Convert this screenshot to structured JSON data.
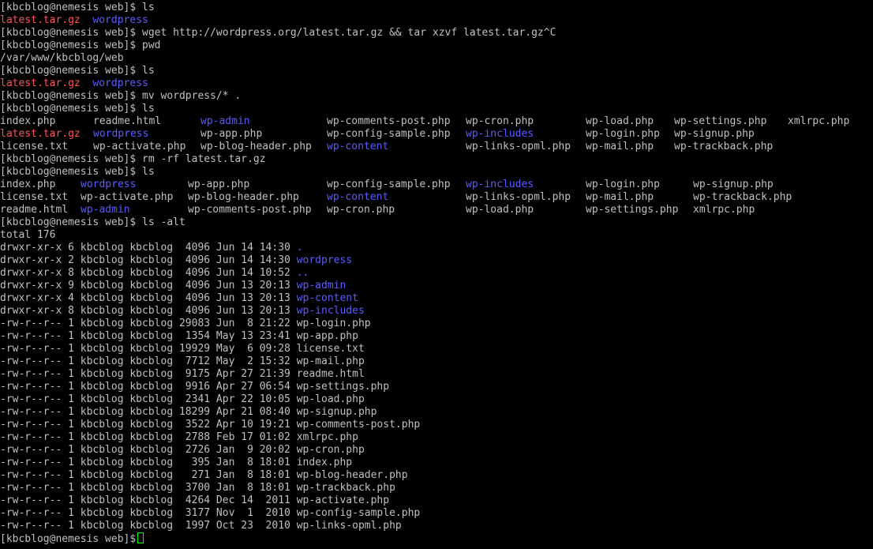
{
  "prompt": "[kbcblog@nemesis web]$",
  "colors": {
    "text": "#c0c0c0",
    "archive": "#ff5555",
    "dir": "#5c5cff",
    "cursor": "#00ff00",
    "bg": "#000000"
  },
  "commands": {
    "c1": "ls",
    "c2": "wget http://wordpress.org/latest.tar.gz && tar xzvf latest.tar.gz^C",
    "c3": "pwd",
    "c4": "ls",
    "c5": "mv wordpress/* .",
    "c6": "ls",
    "c7": "rm -rf latest.tar.gz",
    "c8": "ls",
    "c9": "ls -alt"
  },
  "out1": [
    "latest.tar.gz",
    "wordpress"
  ],
  "pwd_out": "/var/www/kbcblog/web",
  "out4": [
    "latest.tar.gz",
    "wordpress"
  ],
  "ls6": [
    [
      "index.php",
      "readme.html",
      "wp-admin",
      "wp-comments-post.php",
      "wp-cron.php",
      "wp-load.php",
      "wp-settings.php",
      "xmlrpc.php"
    ],
    [
      "latest.tar.gz",
      "wordpress",
      "wp-app.php",
      "wp-config-sample.php",
      "wp-includes",
      "wp-login.php",
      "wp-signup.php"
    ],
    [
      "license.txt",
      "wp-activate.php",
      "wp-blog-header.php",
      "wp-content",
      "wp-links-opml.php",
      "wp-mail.php",
      "wp-trackback.php"
    ]
  ],
  "ls8": [
    [
      "index.php",
      "wordpress",
      "wp-app.php",
      "wp-config-sample.php",
      "wp-includes",
      "wp-login.php",
      "wp-signup.php"
    ],
    [
      "license.txt",
      "wp-activate.php",
      "wp-blog-header.php",
      "wp-content",
      "wp-links-opml.php",
      "wp-mail.php",
      "wp-trackback.php"
    ],
    [
      "readme.html",
      "wp-admin",
      "wp-comments-post.php",
      "wp-cron.php",
      "wp-load.php",
      "wp-settings.php",
      "xmlrpc.php"
    ]
  ],
  "total": "total 176",
  "listing": [
    {
      "meta": "drwxr-xr-x 6 kbcblog kbcblog  4096 Jun 14 14:30 ",
      "name": "."
    },
    {
      "meta": "drwxr-xr-x 2 kbcblog kbcblog  4096 Jun 14 14:30 ",
      "name": "wordpress"
    },
    {
      "meta": "drwxr-xr-x 8 kbcblog kbcblog  4096 Jun 14 10:52 ",
      "name": ".."
    },
    {
      "meta": "drwxr-xr-x 9 kbcblog kbcblog  4096 Jun 13 20:13 ",
      "name": "wp-admin"
    },
    {
      "meta": "drwxr-xr-x 4 kbcblog kbcblog  4096 Jun 13 20:13 ",
      "name": "wp-content"
    },
    {
      "meta": "drwxr-xr-x 8 kbcblog kbcblog  4096 Jun 13 20:13 ",
      "name": "wp-includes"
    },
    {
      "meta": "-rw-r--r-- 1 kbcblog kbcblog 29083 Jun  8 21:22 ",
      "name": "wp-login.php"
    },
    {
      "meta": "-rw-r--r-- 1 kbcblog kbcblog  1354 May 13 23:41 ",
      "name": "wp-app.php"
    },
    {
      "meta": "-rw-r--r-- 1 kbcblog kbcblog 19929 May  6 09:28 ",
      "name": "license.txt"
    },
    {
      "meta": "-rw-r--r-- 1 kbcblog kbcblog  7712 May  2 15:32 ",
      "name": "wp-mail.php"
    },
    {
      "meta": "-rw-r--r-- 1 kbcblog kbcblog  9175 Apr 27 21:39 ",
      "name": "readme.html"
    },
    {
      "meta": "-rw-r--r-- 1 kbcblog kbcblog  9916 Apr 27 06:54 ",
      "name": "wp-settings.php"
    },
    {
      "meta": "-rw-r--r-- 1 kbcblog kbcblog  2341 Apr 22 10:05 ",
      "name": "wp-load.php"
    },
    {
      "meta": "-rw-r--r-- 1 kbcblog kbcblog 18299 Apr 21 08:40 ",
      "name": "wp-signup.php"
    },
    {
      "meta": "-rw-r--r-- 1 kbcblog kbcblog  3522 Apr 10 19:21 ",
      "name": "wp-comments-post.php"
    },
    {
      "meta": "-rw-r--r-- 1 kbcblog kbcblog  2788 Feb 17 01:02 ",
      "name": "xmlrpc.php"
    },
    {
      "meta": "-rw-r--r-- 1 kbcblog kbcblog  2726 Jan  9 20:02 ",
      "name": "wp-cron.php"
    },
    {
      "meta": "-rw-r--r-- 1 kbcblog kbcblog   395 Jan  8 18:01 ",
      "name": "index.php"
    },
    {
      "meta": "-rw-r--r-- 1 kbcblog kbcblog   271 Jan  8 18:01 ",
      "name": "wp-blog-header.php"
    },
    {
      "meta": "-rw-r--r-- 1 kbcblog kbcblog  3700 Jan  8 18:01 ",
      "name": "wp-trackback.php"
    },
    {
      "meta": "-rw-r--r-- 1 kbcblog kbcblog  4264 Dec 14  2011 ",
      "name": "wp-activate.php"
    },
    {
      "meta": "-rw-r--r-- 1 kbcblog kbcblog  3177 Nov  1  2010 ",
      "name": "wp-config-sample.php"
    },
    {
      "meta": "-rw-r--r-- 1 kbcblog kbcblog  1997 Oct 23  2010 ",
      "name": "wp-links-opml.php"
    }
  ]
}
